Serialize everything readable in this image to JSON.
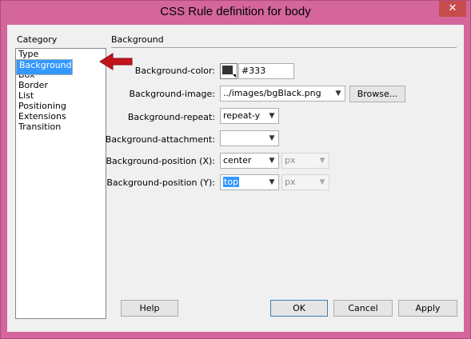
{
  "window": {
    "title": "CSS Rule definition for body",
    "close_glyph": "✕"
  },
  "category": {
    "label": "Category",
    "items": [
      "Type",
      "Background",
      "Block",
      "Box",
      "Border",
      "List",
      "Positioning",
      "Extensions",
      "Transition"
    ],
    "selected": "Background"
  },
  "section": {
    "title": "Background"
  },
  "fields": {
    "bg_color": {
      "label": "Background-color:",
      "value": "#333",
      "swatch": "#333333"
    },
    "bg_image": {
      "label": "Background-image:",
      "value": "../images/bgBlack.png",
      "browse": "Browse..."
    },
    "bg_repeat": {
      "label": "Background-repeat:",
      "value": "repeat-y"
    },
    "bg_attachment": {
      "label": "Background-attachment:",
      "value": ""
    },
    "bg_pos_x": {
      "label": "Background-position (X):",
      "value": "center",
      "unit": "px"
    },
    "bg_pos_y": {
      "label": "Background-position (Y):",
      "value": "top",
      "unit": "px"
    }
  },
  "buttons": {
    "help": "Help",
    "ok": "OK",
    "cancel": "Cancel",
    "apply": "Apply"
  },
  "colors": {
    "frame": "#d4669c",
    "selection": "#3399ff",
    "arrow": "#c0141c"
  }
}
